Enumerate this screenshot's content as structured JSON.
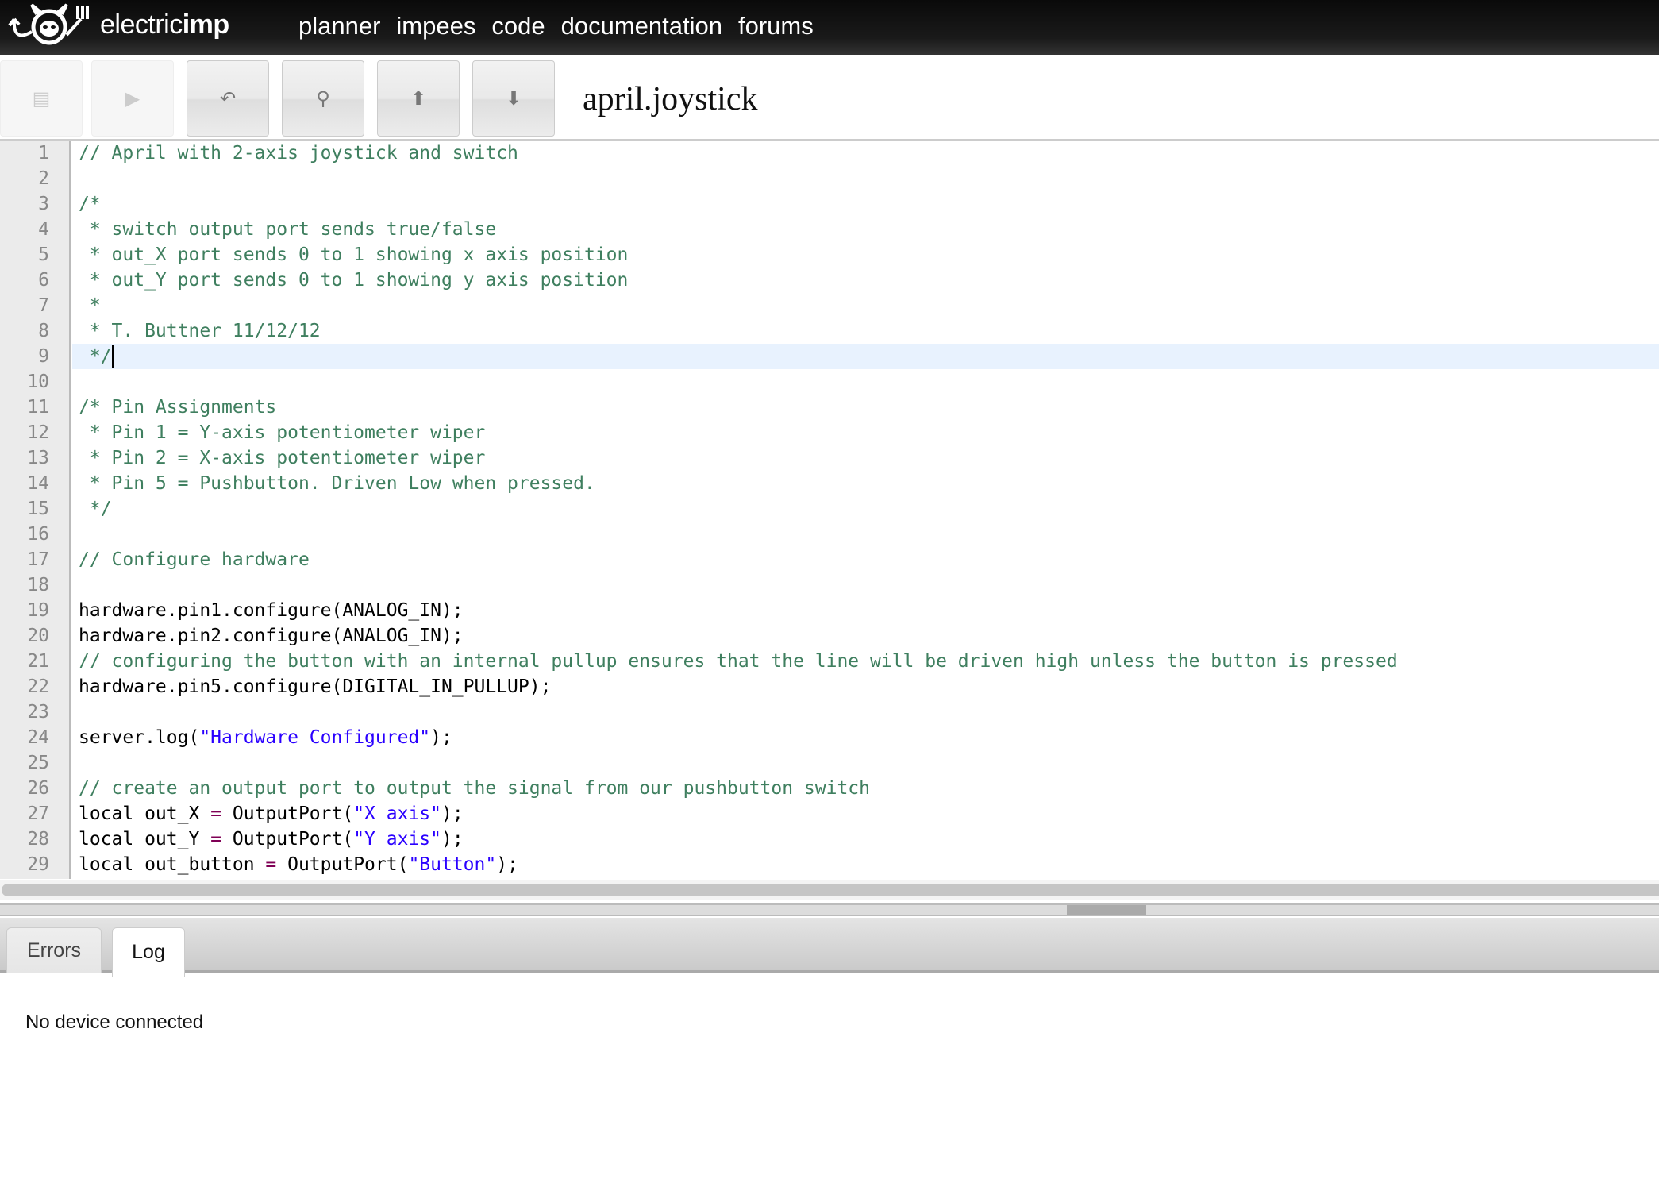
{
  "header": {
    "brand_light": "electric",
    "brand_bold": "imp",
    "nav": [
      "planner",
      "impees",
      "code",
      "documentation",
      "forums"
    ]
  },
  "toolbar": {
    "buttons": [
      {
        "name": "save-button",
        "icon": "save-icon",
        "glyph": "▤",
        "disabled": true
      },
      {
        "name": "run-button",
        "icon": "play-icon",
        "glyph": "▶",
        "disabled": true
      },
      {
        "name": "undo-button",
        "icon": "undo-icon",
        "glyph": "↶",
        "disabled": false
      },
      {
        "name": "search-button",
        "icon": "search-icon",
        "glyph": "⚲",
        "disabled": false
      },
      {
        "name": "upload-button",
        "icon": "arrow-up-circle-icon",
        "glyph": "⬆",
        "disabled": false
      },
      {
        "name": "download-button",
        "icon": "arrow-down-circle-icon",
        "glyph": "⬇",
        "disabled": false
      }
    ],
    "file_title": "april.joystick"
  },
  "editor": {
    "current_line": 9,
    "lines": [
      [
        [
          "comment",
          "// April with 2-axis joystick and switch"
        ]
      ],
      [],
      [
        [
          "comment",
          "/*"
        ]
      ],
      [
        [
          "comment",
          " * switch output port sends true/false"
        ]
      ],
      [
        [
          "comment",
          " * out_X port sends 0 to 1 showing x axis position"
        ]
      ],
      [
        [
          "comment",
          " * out_Y port sends 0 to 1 showing y axis position"
        ]
      ],
      [
        [
          "comment",
          " *"
        ]
      ],
      [
        [
          "comment",
          " * T. Buttner 11/12/12"
        ]
      ],
      [
        [
          "comment",
          " */"
        ]
      ],
      [],
      [
        [
          "comment",
          "/* Pin Assignments"
        ]
      ],
      [
        [
          "comment",
          " * Pin 1 = Y-axis potentiometer wiper"
        ]
      ],
      [
        [
          "comment",
          " * Pin 2 = X-axis potentiometer wiper"
        ]
      ],
      [
        [
          "comment",
          " * Pin 5 = Pushbutton. Driven Low when pressed."
        ]
      ],
      [
        [
          "comment",
          " */"
        ]
      ],
      [],
      [
        [
          "comment",
          "// Configure hardware"
        ]
      ],
      [],
      [
        [
          "code",
          "hardware.pin1.configure(ANALOG_IN);"
        ]
      ],
      [
        [
          "code",
          "hardware.pin2.configure(ANALOG_IN);"
        ]
      ],
      [
        [
          "comment",
          "// configuring the button with an internal pullup ensures that the line will be driven high unless the button is pressed"
        ]
      ],
      [
        [
          "code",
          "hardware.pin5.configure(DIGITAL_IN_PULLUP);"
        ]
      ],
      [],
      [
        [
          "code",
          "server.log("
        ],
        [
          "string",
          "\"Hardware Configured\""
        ],
        [
          "code",
          ");"
        ]
      ],
      [],
      [
        [
          "comment",
          "// create an output port to output the signal from our pushbutton switch"
        ]
      ],
      [
        [
          "code",
          "local out_X "
        ],
        [
          "op",
          "="
        ],
        [
          "code",
          " OutputPort("
        ],
        [
          "string",
          "\"X axis\""
        ],
        [
          "code",
          ");"
        ]
      ],
      [
        [
          "code",
          "local out_Y "
        ],
        [
          "op",
          "="
        ],
        [
          "code",
          " OutputPort("
        ],
        [
          "string",
          "\"Y axis\""
        ],
        [
          "code",
          ");"
        ]
      ],
      [
        [
          "code",
          "local out_button "
        ],
        [
          "op",
          "="
        ],
        [
          "code",
          " OutputPort("
        ],
        [
          "string",
          "\"Button\""
        ],
        [
          "code",
          ");"
        ]
      ]
    ]
  },
  "console": {
    "tabs": [
      "Errors",
      "Log"
    ],
    "active_tab": "Log",
    "message": "No device connected"
  }
}
